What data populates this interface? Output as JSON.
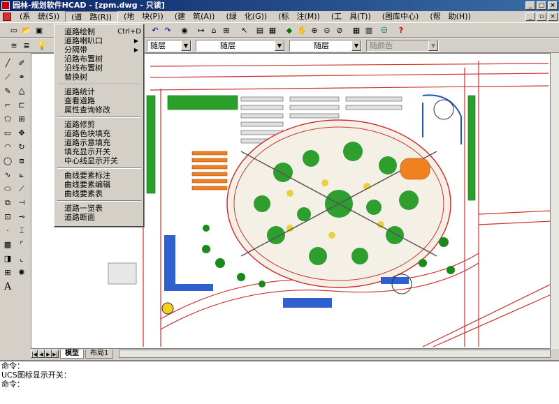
{
  "window": {
    "title": "园林-规划软件HCAD - [zpm.dwg - 只读]"
  },
  "menubar": [
    {
      "label": "(系　统(S))"
    },
    {
      "label": "(道　路(R))"
    },
    {
      "label": "(地　块(P))"
    },
    {
      "label": "(建　筑(A))"
    },
    {
      "label": "(绿　化(G))"
    },
    {
      "label": "(标　注(M))"
    },
    {
      "label": "(工　具(T))"
    },
    {
      "label": "(图库中心)"
    },
    {
      "label": "(帮　助(H))"
    }
  ],
  "layer_toolbar": {
    "layer_value": "随层",
    "linetype_value": "随层",
    "lineweight_value": "随层",
    "color_value": "随颜色"
  },
  "road_menu": {
    "groups": [
      [
        {
          "label": "道路绘制",
          "shortcut": "Ctrl+D"
        },
        {
          "label": "道路喇叭口",
          "submenu": true
        },
        {
          "label": "分隔带",
          "submenu": true
        },
        {
          "label": "沿路布置树"
        },
        {
          "label": "沿线布置树"
        },
        {
          "label": "替换树"
        }
      ],
      [
        {
          "label": "道路统计"
        },
        {
          "label": "查看道路"
        },
        {
          "label": "属性查询修改"
        }
      ],
      [
        {
          "label": "道路修剪"
        },
        {
          "label": "道路色块填充"
        },
        {
          "label": "道路示意填充"
        },
        {
          "label": "填充显示开关"
        },
        {
          "label": "中心线显示开关"
        }
      ],
      [
        {
          "label": "曲线要素标注"
        },
        {
          "label": "曲线要素编辑"
        },
        {
          "label": "曲线要素表"
        }
      ],
      [
        {
          "label": "道路一览表"
        },
        {
          "label": "道路断面"
        }
      ]
    ]
  },
  "tabs": [
    {
      "label": "模型",
      "active": true
    },
    {
      "label": "布局1",
      "active": false
    }
  ],
  "command_lines": [
    "命令：",
    "UCS图标显示开关：",
    "命令："
  ],
  "colors": {
    "title_start": "#0a246a",
    "title_end": "#3a6ea5",
    "chrome": "#d4d0c8",
    "road": "#d03030",
    "green": "#1a8a1a"
  }
}
